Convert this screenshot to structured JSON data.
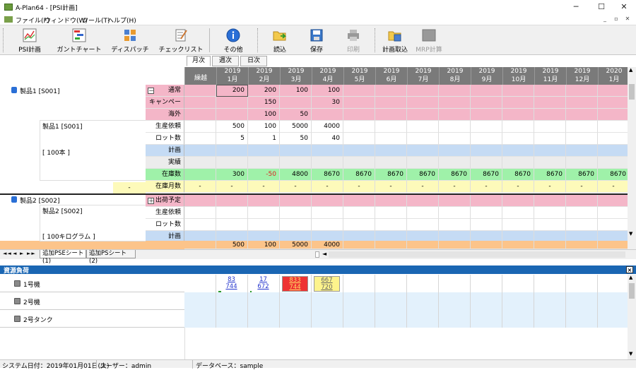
{
  "window": {
    "title": "A-Plan64 - [PSI計画]",
    "controls": [
      "─",
      "☐",
      "✕"
    ]
  },
  "menu": {
    "items": [
      "ファイル(F)",
      "ウィンドウ(W)",
      "ツール(T)",
      "ヘルプ(H)"
    ],
    "mdi_controls": [
      "_",
      "▫",
      "✕"
    ]
  },
  "toolbar": {
    "buttons": [
      {
        "label": "PSI計画",
        "icon": "psi-chart-icon"
      },
      {
        "label": "ガントチャート",
        "icon": "gantt-chart-icon"
      },
      {
        "label": "ディスパッチ",
        "icon": "dispatch-icon"
      },
      {
        "label": "チェックリスト",
        "icon": "checklist-icon"
      },
      {
        "label": "その他",
        "icon": "info-icon"
      },
      {
        "label": "読込",
        "icon": "open-folder-icon"
      },
      {
        "label": "保存",
        "icon": "save-disk-icon"
      },
      {
        "label": "印刷",
        "icon": "printer-icon"
      },
      {
        "label": "計画取込",
        "icon": "import-plan-icon"
      },
      {
        "label": "MRP計算",
        "icon": "mrp-calc-icon"
      }
    ]
  },
  "view_tabs": [
    "月次",
    "週次",
    "日次"
  ],
  "grid": {
    "carryover_label": "繰越",
    "months": [
      [
        "2019",
        "1月"
      ],
      [
        "2019",
        "2月"
      ],
      [
        "2019",
        "3月"
      ],
      [
        "2019",
        "4月"
      ],
      [
        "2019",
        "5月"
      ],
      [
        "2019",
        "6月"
      ],
      [
        "2019",
        "7月"
      ],
      [
        "2019",
        "8月"
      ],
      [
        "2019",
        "9月"
      ],
      [
        "2019",
        "10月"
      ],
      [
        "2019",
        "11月"
      ],
      [
        "2019",
        "12月"
      ],
      [
        "2020",
        "1月"
      ]
    ],
    "product1": {
      "name": "製品1  [S001]",
      "sub_name": "製品1  [S001]",
      "unit": "[ 100本 ]",
      "expand": "－",
      "rows": [
        {
          "label": "通常",
          "color": "pink",
          "values": [
            "",
            "200",
            "200",
            "100",
            "100",
            "",
            "",
            "",
            "",
            "",
            "",
            "",
            "",
            ""
          ]
        },
        {
          "label": "キャンペーン",
          "color": "pink",
          "values": [
            "",
            "",
            "150",
            "",
            "30",
            "",
            "",
            "",
            "",
            "",
            "",
            "",
            "",
            ""
          ]
        },
        {
          "label": "海外",
          "color": "pink",
          "values": [
            "",
            "",
            "100",
            "50",
            "",
            "",
            "",
            "",
            "",
            "",
            "",
            "",
            "",
            ""
          ]
        },
        {
          "label": "生産依頼",
          "color": "white",
          "values": [
            "",
            "500",
            "100",
            "5000",
            "4000",
            "",
            "",
            "",
            "",
            "",
            "",
            "",
            "",
            ""
          ]
        },
        {
          "label": "ロット数",
          "color": "white",
          "values": [
            "",
            "5",
            "1",
            "50",
            "40",
            "",
            "",
            "",
            "",
            "",
            "",
            "",
            "",
            ""
          ]
        },
        {
          "label": "計画",
          "color": "blue",
          "values": [
            "",
            "",
            "",
            "",
            "",
            "",
            "",
            "",
            "",
            "",
            "",
            "",
            "",
            ""
          ]
        },
        {
          "label": "実績",
          "color": "grey",
          "values": [
            "",
            "",
            "",
            "",
            "",
            "",
            "",
            "",
            "",
            "",
            "",
            "",
            "",
            ""
          ]
        },
        {
          "label": "在庫数",
          "color": "green",
          "values": [
            "",
            "300",
            "-50",
            "4800",
            "8670",
            "8670",
            "8670",
            "8670",
            "8670",
            "8670",
            "8670",
            "8670",
            "8670",
            "8670"
          ]
        },
        {
          "label": "在庫月数",
          "color": "yellow",
          "values": [
            "-",
            "-",
            "-",
            "-",
            "-",
            "-",
            "-",
            "-",
            "-",
            "-",
            "-",
            "-",
            "-",
            "-"
          ]
        }
      ],
      "stock_months_left": "-"
    },
    "product2": {
      "name": "製品2  [S002]",
      "sub_name": "製品2  [S002]",
      "unit": "[ 100キログラム ]",
      "expand": "＋",
      "rows": [
        {
          "label": "出荷予定",
          "color": "pink"
        },
        {
          "label": "生産依頼",
          "color": "white"
        },
        {
          "label": "ロット数",
          "color": "white"
        },
        {
          "label": "計画",
          "color": "blue"
        }
      ]
    },
    "totals": [
      "",
      "500",
      "100",
      "5000",
      "4000",
      "",
      "",
      "",
      "",
      "",
      "",
      "",
      "",
      ""
    ]
  },
  "sheet_tabs": [
    "追加PSEシート(1)",
    "追加PSシート(2)"
  ],
  "sheet_nav": [
    "◄◄",
    "◄",
    "►",
    "►►"
  ],
  "resource_panel": {
    "title": "資源負荷",
    "resources": [
      "1号機",
      "2号機",
      "2号タンク"
    ],
    "loads": [
      {
        "col": 1,
        "top": "83",
        "bottom": "744",
        "color": "#ffffff",
        "text_color": "#2233cc",
        "fill": 0.11
      },
      {
        "col": 2,
        "top": "17",
        "bottom": "672",
        "color": "#ffffff",
        "text_color": "#2233cc",
        "fill": 0.03
      },
      {
        "col": 3,
        "top": "833",
        "bottom": "744",
        "color": "#ee3333",
        "text_color": "#ffe066",
        "fill": 1.0
      },
      {
        "col": 4,
        "top": "667",
        "bottom": "720",
        "color": "#fdf38c",
        "text_color": "#666666",
        "fill": 0.93
      }
    ]
  },
  "status": {
    "date": "システム日付：2019年01月01日(火)",
    "user": "ユーザー：admin",
    "db": "データベース：sample"
  }
}
